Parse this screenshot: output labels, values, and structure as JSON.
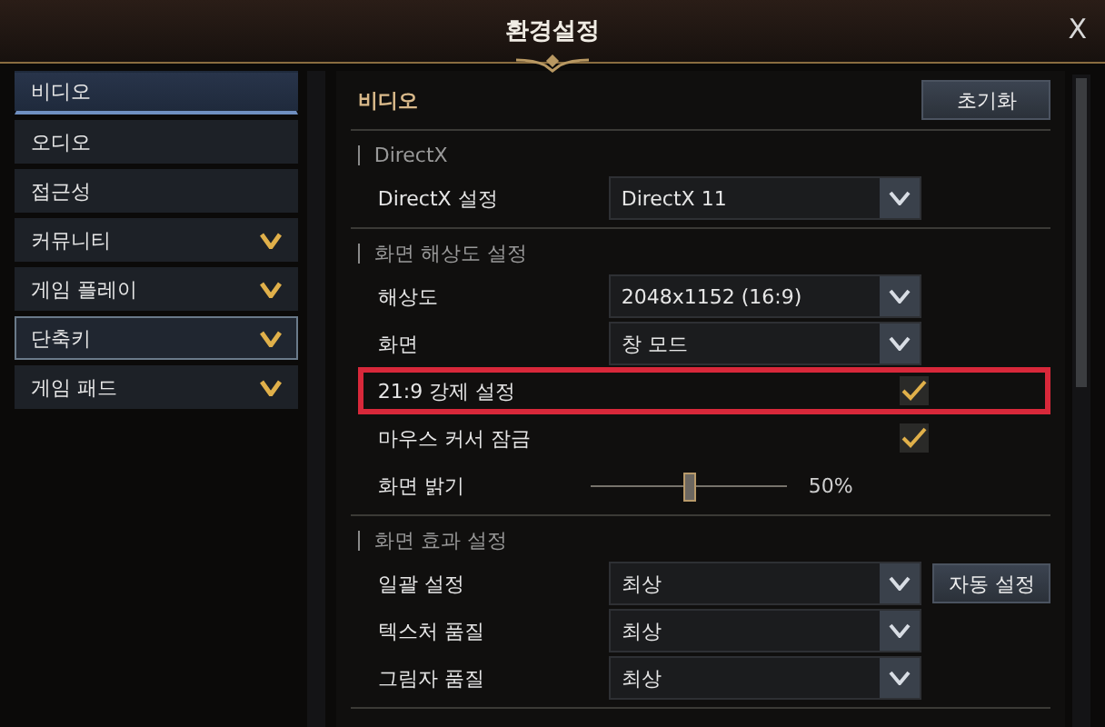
{
  "window": {
    "title": "환경설정",
    "close": "X"
  },
  "sidebar": {
    "items": [
      {
        "label": "비디오",
        "selected": true,
        "hovered": false,
        "has_submenu": false
      },
      {
        "label": "오디오",
        "selected": false,
        "hovered": false,
        "has_submenu": false
      },
      {
        "label": "접근성",
        "selected": false,
        "hovered": false,
        "has_submenu": false
      },
      {
        "label": "커뮤니티",
        "selected": false,
        "hovered": false,
        "has_submenu": true
      },
      {
        "label": "게임 플레이",
        "selected": false,
        "hovered": false,
        "has_submenu": true
      },
      {
        "label": "단축키",
        "selected": false,
        "hovered": true,
        "has_submenu": true
      },
      {
        "label": "게임 패드",
        "selected": false,
        "hovered": false,
        "has_submenu": true
      }
    ]
  },
  "panel": {
    "title": "비디오",
    "reset_button": "초기화",
    "sections": [
      {
        "title": "DirectX",
        "rows": [
          {
            "kind": "select",
            "label": "DirectX 설정",
            "value": "DirectX 11",
            "highlighted": false
          }
        ]
      },
      {
        "title": "화면 해상도 설정",
        "rows": [
          {
            "kind": "select",
            "label": "해상도",
            "value": "2048x1152 (16:9)",
            "highlighted": false
          },
          {
            "kind": "select",
            "label": "화면",
            "value": "창 모드",
            "highlighted": false
          },
          {
            "kind": "check",
            "label": "21:9 강제 설정",
            "checked": true,
            "highlighted": true
          },
          {
            "kind": "check",
            "label": "마우스 커서 잠금",
            "checked": true,
            "highlighted": false
          },
          {
            "kind": "slider",
            "label": "화면 밝기",
            "level": 0.5,
            "reading": "50%",
            "highlighted": false
          }
        ]
      },
      {
        "title": "화면 효과 설정",
        "rows": [
          {
            "kind": "select",
            "label": "일괄 설정",
            "value": "최상",
            "button": "자동 설정",
            "highlighted": false
          },
          {
            "kind": "select",
            "label": "텍스처 품질",
            "value": "최상",
            "highlighted": false
          },
          {
            "kind": "select",
            "label": "그림자 품질",
            "value": "최상",
            "highlighted": false
          }
        ]
      }
    ]
  }
}
